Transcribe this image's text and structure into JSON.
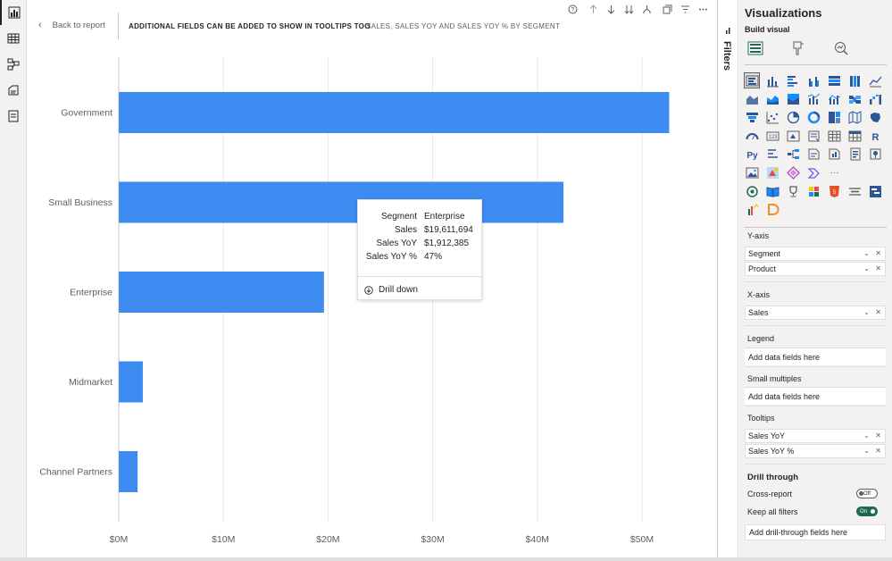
{
  "header": {
    "back_label": "Back to report",
    "title": "ADDITIONAL FIELDS CAN BE ADDED TO SHOW IN TOOLTIPS TOO",
    "subtitle": "SALES, SALES YOY AND SALES YOY % BY SEGMENT"
  },
  "chart_data": {
    "type": "bar",
    "orientation": "horizontal",
    "categories": [
      "Government",
      "Small Business",
      "Enterprise",
      "Midmarket",
      "Channel Partners"
    ],
    "values": [
      52.6,
      42.5,
      19.61,
      2.3,
      1.8
    ],
    "xlim": [
      0,
      55
    ],
    "x_ticks": [
      "$0M",
      "$10M",
      "$20M",
      "$30M",
      "$40M",
      "$50M"
    ],
    "x_tick_values": [
      0,
      10,
      20,
      30,
      40,
      50
    ],
    "grid": true,
    "bar_color": "#3e8bf2"
  },
  "tooltip": {
    "rows": [
      {
        "label": "Segment",
        "value": "Enterprise"
      },
      {
        "label": "Sales",
        "value": "$19,611,694"
      },
      {
        "label": "Sales YoY",
        "value": "$1,912,385"
      },
      {
        "label": "Sales YoY %",
        "value": "47%"
      }
    ],
    "action_label": "Drill down"
  },
  "filters_label": "Filters",
  "viz_pane": {
    "title": "Visualizations",
    "build_label": "Build visual",
    "wells": {
      "y_axis": {
        "label": "Y-axis",
        "fields": [
          "Segment",
          "Product"
        ]
      },
      "x_axis": {
        "label": "X-axis",
        "fields": [
          "Sales"
        ]
      },
      "legend": {
        "label": "Legend",
        "placeholder": "Add data fields here"
      },
      "small_multiples": {
        "label": "Small multiples",
        "placeholder": "Add data fields here"
      },
      "tooltips": {
        "label": "Tooltips",
        "fields": [
          "Sales YoY",
          "Sales YoY %"
        ]
      }
    },
    "drill_through": {
      "title": "Drill through",
      "cross_report": {
        "label": "Cross-report",
        "state": "Off"
      },
      "keep_filters": {
        "label": "Keep all filters",
        "state": "On"
      },
      "placeholder": "Add drill-through fields here"
    },
    "extra_glyphs": {
      "r": "R",
      "py": "Py",
      "more": "···"
    }
  },
  "colors": {
    "accent": "#3e8bf2",
    "brand_green": "#1e6b52",
    "pane_bg": "#f3f2f1"
  }
}
